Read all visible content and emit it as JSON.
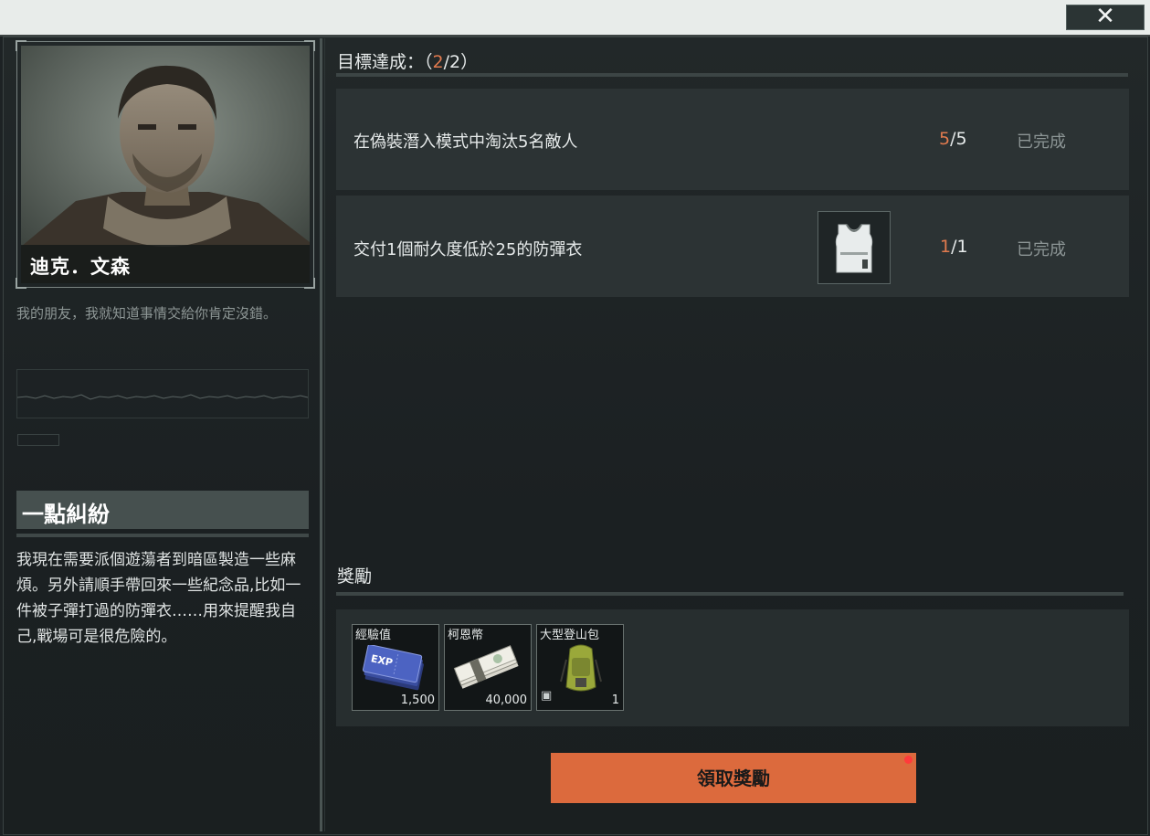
{
  "window": {
    "close_glyph": "✕"
  },
  "npc": {
    "name": "迪克．文森",
    "quote": "我的朋友，我就知道事情交給你肯定沒錯。"
  },
  "mission": {
    "title": "一點糾紛",
    "description": "我現在需要派個遊蕩者到暗區製造一些麻煩。另外請順手帶回來一些紀念品,比如一件被子彈打過的防彈衣……用來提醒我自己,戰場可是很危險的。"
  },
  "objectives": {
    "label": "目標達成：",
    "progress_open": "（",
    "progress_done": "2",
    "progress_total": "/2）",
    "items": [
      {
        "text": "在偽裝潛入模式中淘汰5名敵人",
        "done": "5",
        "total": "/5",
        "status": "已完成"
      },
      {
        "text": "交付1個耐久度低於25的防彈衣",
        "done": "1",
        "total": "/1",
        "status": "已完成",
        "icon": "vest-icon"
      }
    ]
  },
  "rewards": {
    "label": "獎勵",
    "items": [
      {
        "name": "經驗值",
        "qty": "1,500",
        "icon": "exp-ticket-icon"
      },
      {
        "name": "柯恩幣",
        "qty": "40,000",
        "icon": "cash-stack-icon"
      },
      {
        "name": "大型登山包",
        "qty": "1",
        "icon": "backpack-icon"
      }
    ]
  },
  "claim_button": {
    "label": "領取獎勵"
  },
  "colors": {
    "accent": "#e07a4e",
    "button": "#dc6a3d",
    "status": "#8c9595"
  }
}
